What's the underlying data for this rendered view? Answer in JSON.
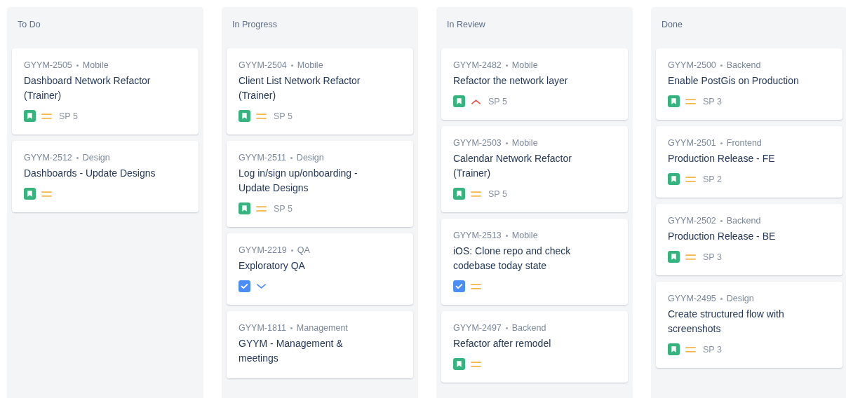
{
  "columns": [
    {
      "title": "To Do",
      "cards": [
        {
          "key": "GYYM-2505",
          "component": "Mobile",
          "title": "Dashboard Network Refactor (Trainer)",
          "icons": [
            {
              "kind": "story"
            },
            {
              "kind": "medium"
            }
          ],
          "points": "SP 5"
        },
        {
          "key": "GYYM-2512",
          "component": "Design",
          "title": "Dashboards - Update Designs",
          "icons": [
            {
              "kind": "story"
            },
            {
              "kind": "medium"
            }
          ]
        }
      ]
    },
    {
      "title": "In Progress",
      "cards": [
        {
          "key": "GYYM-2504",
          "component": "Mobile",
          "title": "Client List Network Refactor (Trainer)",
          "icons": [
            {
              "kind": "story"
            },
            {
              "kind": "medium"
            }
          ],
          "points": "SP 5"
        },
        {
          "key": "GYYM-2511",
          "component": "Design",
          "title": "Log in/sign up/onboarding - Update Designs",
          "icons": [
            {
              "kind": "story"
            },
            {
              "kind": "medium"
            }
          ],
          "points": "SP 5"
        },
        {
          "key": "GYYM-2219",
          "component": "QA",
          "title": "Exploratory QA",
          "icons": [
            {
              "kind": "task"
            },
            {
              "kind": "low"
            }
          ]
        },
        {
          "key": "GYYM-1811",
          "component": "Management",
          "title": "GYYM - Management & meetings"
        }
      ]
    },
    {
      "title": "In Review",
      "cards": [
        {
          "key": "GYYM-2482",
          "component": "Mobile",
          "title": "Refactor the network layer",
          "icons": [
            {
              "kind": "story"
            },
            {
              "kind": "high"
            }
          ],
          "points": "SP 5"
        },
        {
          "key": "GYYM-2503",
          "component": "Mobile",
          "title": "Calendar Network Refactor (Trainer)",
          "icons": [
            {
              "kind": "story"
            },
            {
              "kind": "medium"
            }
          ],
          "points": "SP 5"
        },
        {
          "key": "GYYM-2513",
          "component": "Mobile",
          "title": "iOS: Clone repo and check codebase today state",
          "icons": [
            {
              "kind": "task"
            },
            {
              "kind": "medium"
            }
          ]
        },
        {
          "key": "GYYM-2497",
          "component": "Backend",
          "title": "Refactor after remodel",
          "icons": [
            {
              "kind": "story"
            },
            {
              "kind": "medium"
            }
          ]
        }
      ]
    },
    {
      "title": "Done",
      "cards": [
        {
          "key": "GYYM-2500",
          "component": "Backend",
          "title": "Enable PostGis on Production",
          "icons": [
            {
              "kind": "story"
            },
            {
              "kind": "medium"
            }
          ],
          "points": "SP 3"
        },
        {
          "key": "GYYM-2501",
          "component": "Frontend",
          "title": "Production Release - FE",
          "icons": [
            {
              "kind": "story"
            },
            {
              "kind": "medium"
            }
          ],
          "points": "SP 2"
        },
        {
          "key": "GYYM-2502",
          "component": "Backend",
          "title": "Production Release - BE",
          "icons": [
            {
              "kind": "story"
            },
            {
              "kind": "medium"
            }
          ],
          "points": "SP 3"
        },
        {
          "key": "GYYM-2495",
          "component": "Design",
          "title": "Create structured flow with screenshots",
          "icons": [
            {
              "kind": "story"
            },
            {
              "kind": "medium"
            }
          ],
          "points": "SP 3"
        }
      ]
    }
  ]
}
